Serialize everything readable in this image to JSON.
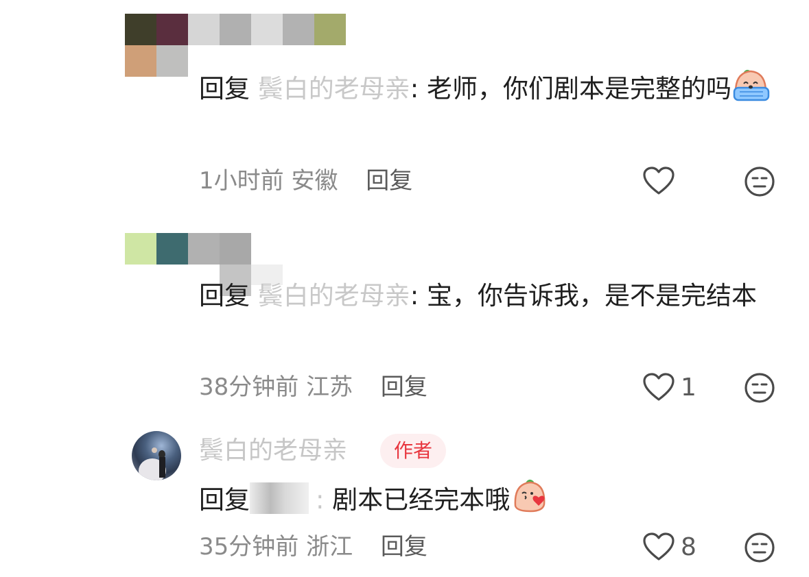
{
  "colors": {
    "text": "#1f1f1f",
    "muted": "#8a8a8a",
    "username_faded": "#c8c8c8",
    "author_badge_bg": "#fdeff0",
    "author_badge_text": "#e8363f"
  },
  "comments": [
    {
      "reply_prefix": "回复",
      "reply_target": "鬓白的老母亲",
      "separator": ":",
      "text": " 老师，你们剧本是完整的吗",
      "emoji": "crying-peach-emoji",
      "time": "1小时前",
      "location": "安徽",
      "reply_label": "回复",
      "like_count": ""
    },
    {
      "reply_prefix": "回复",
      "reply_target": "鬓白的老母亲",
      "separator": ":",
      "text": " 宝，你告诉我，是不是完结本",
      "time": "38分钟前",
      "location": "江苏",
      "reply_label": "回复",
      "like_count": "1"
    },
    {
      "author_name": "鬓白的老母亲",
      "author_badge": "作者",
      "reply_prefix": "回复",
      "separator": ":",
      "text": " 剧本已经完本哦",
      "emoji": "blowing-kiss-peach-emoji",
      "time": "35分钟前",
      "location": "浙江",
      "reply_label": "回复",
      "like_count": "8"
    }
  ]
}
